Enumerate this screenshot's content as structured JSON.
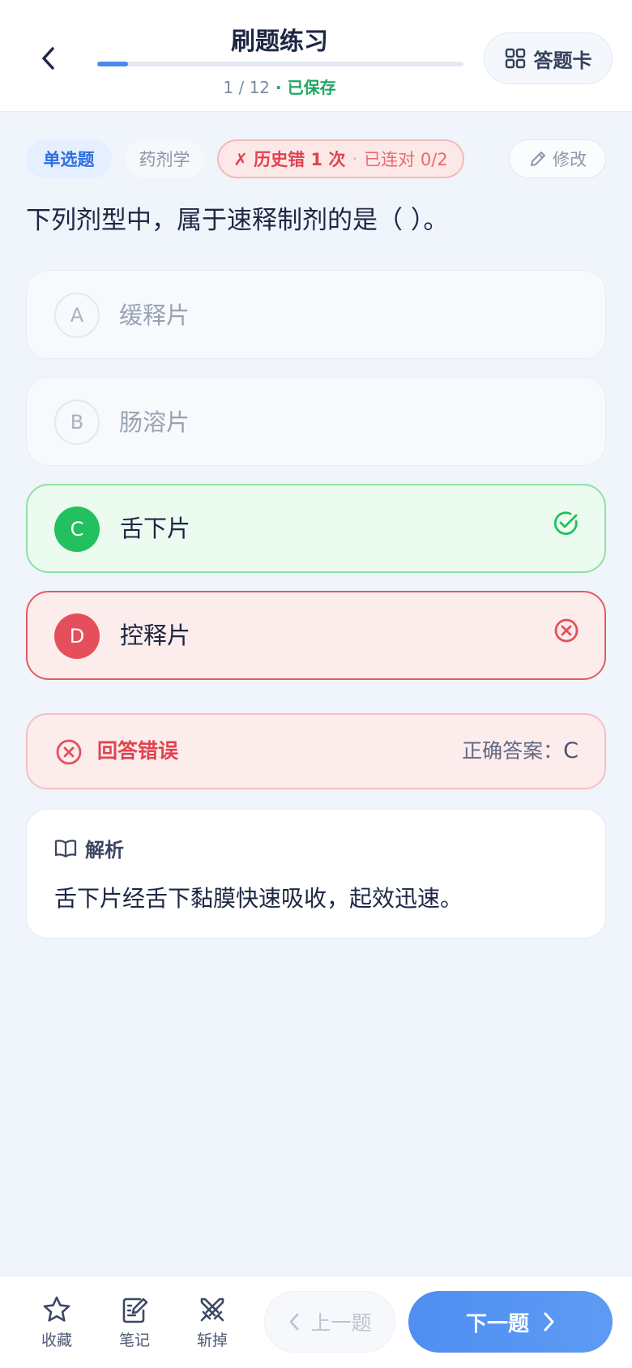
{
  "header": {
    "title": "刷题练习",
    "progress_text": "1 / 12",
    "separator": " · ",
    "saved_label": "已保存",
    "progress_fraction": 0.083,
    "card_button_label": "答题卡"
  },
  "tags": {
    "type": "单选题",
    "subject": "药剂学",
    "history_main": "✗ 历史错 1 次",
    "history_dot": "·",
    "history_streak": "已连对 0/2",
    "edit_label": "修改"
  },
  "question": {
    "text": "下列剂型中，属于速释制剂的是（ ）。"
  },
  "options": [
    {
      "letter": "A",
      "text": "缓释片",
      "state": "normal"
    },
    {
      "letter": "B",
      "text": "肠溶片",
      "state": "normal"
    },
    {
      "letter": "C",
      "text": "舌下片",
      "state": "correct"
    },
    {
      "letter": "D",
      "text": "控释片",
      "state": "wrong-selected"
    }
  ],
  "result": {
    "label": "回答错误",
    "answer_prefix": "正确答案：",
    "answer_value": "C"
  },
  "analysis": {
    "title": "解析",
    "text": "舌下片经舌下黏膜快速吸收，起效迅速。"
  },
  "bottom": {
    "favorite_label": "收藏",
    "note_label": "笔记",
    "cut_label": "斩掉",
    "prev_label": "上一题",
    "next_label": "下一题"
  },
  "colors": {
    "accent_blue": "#4a8af0",
    "correct_green": "#22c05e",
    "wrong_red": "#e44f5b"
  }
}
